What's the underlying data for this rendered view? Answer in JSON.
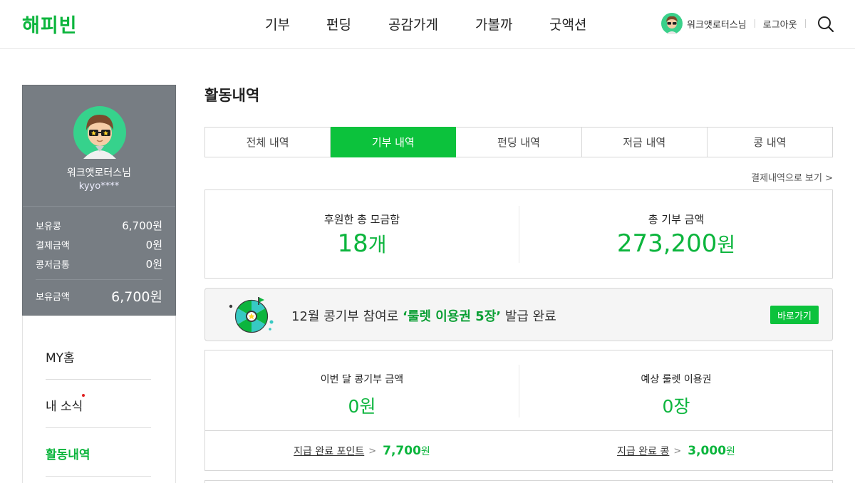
{
  "header": {
    "logo": "해피빈",
    "nav": [
      "기부",
      "펀딩",
      "공감가게",
      "가볼까",
      "굿액션"
    ],
    "user_name": "워크앳로터스님",
    "logout": "로그아웃"
  },
  "profile": {
    "name": "워크앳로터스님",
    "id": "kyyo****",
    "stats": [
      {
        "label": "보유콩",
        "value": "6,700원"
      },
      {
        "label": "결제금액",
        "value": "0원"
      },
      {
        "label": "콩저금통",
        "value": "0원"
      }
    ],
    "total": {
      "label": "보유금액",
      "value": "6,700원"
    }
  },
  "menu": {
    "items": [
      {
        "label": "MY홈"
      },
      {
        "label": "내 소식"
      },
      {
        "label": "활동내역"
      }
    ]
  },
  "main": {
    "title": "활동내역",
    "tabs": [
      "전체 내역",
      "기부 내역",
      "펀딩 내역",
      "저금 내역",
      "콩 내역"
    ],
    "active_tab": "기부 내역",
    "pay_link": "결제내역으로 보기 >",
    "summary": {
      "left": {
        "label": "후원한 총 모금함",
        "number": "18",
        "unit": "개"
      },
      "right": {
        "label": "총 기부 금액",
        "number": "273,200",
        "unit": "원"
      }
    },
    "banner": {
      "text_before": "12월 콩기부 참여로 ",
      "highlight": "‘룰렛 이용권 5장’",
      "text_after": " 발급 완료",
      "button": "바로가기"
    },
    "monthly": {
      "left": {
        "label": "이번 달 콩기부 금액",
        "value": "0원"
      },
      "right": {
        "label": "예상 룰렛 이용권",
        "value": "0장"
      },
      "points": [
        {
          "label": "지급 완료 포인트",
          "arrow": ">",
          "number": "7,700",
          "unit": "원"
        },
        {
          "label": "지급 완료 콩",
          "arrow": ">",
          "number": "3,000",
          "unit": "원"
        }
      ]
    }
  },
  "colors": {
    "brand_green": "#0cb53d",
    "active_tab": "#0cc23c",
    "profile_panel": "#777d83",
    "notification_dot": "#e02020"
  }
}
